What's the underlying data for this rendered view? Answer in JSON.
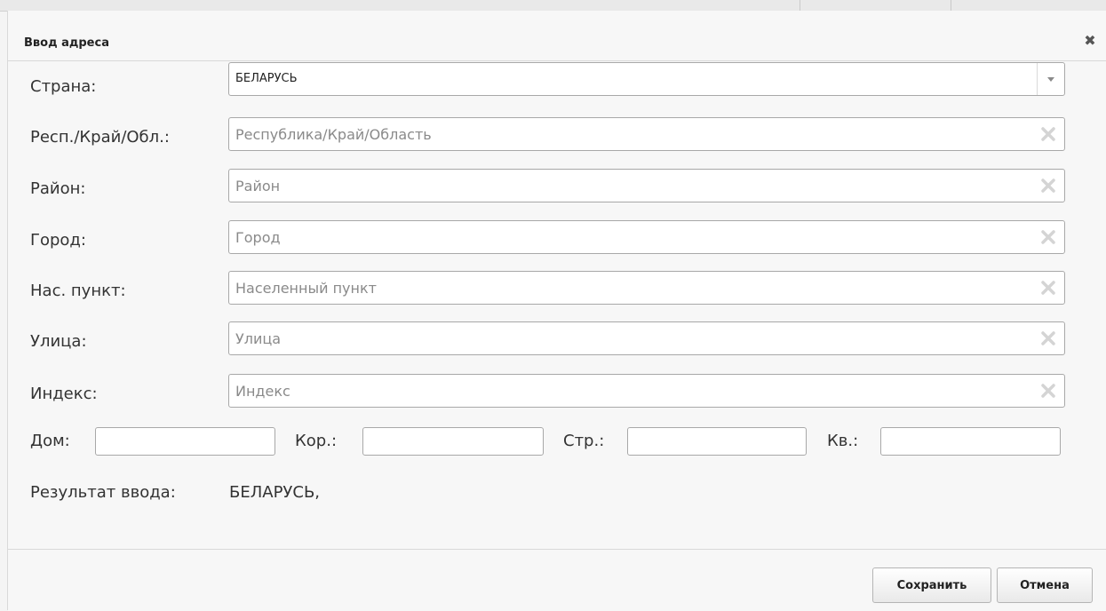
{
  "dialog": {
    "title": "Ввод адреса",
    "close_icon": "close-icon"
  },
  "form": {
    "country": {
      "label": "Страна:",
      "value": "БЕЛАРУСЬ",
      "icon": "chevron-down-icon"
    },
    "region": {
      "label": "Респ./Край/Обл.:",
      "placeholder": "Республика/Край/Область",
      "value": ""
    },
    "district": {
      "label": "Район:",
      "placeholder": "Район",
      "value": ""
    },
    "city": {
      "label": "Город:",
      "placeholder": "Город",
      "value": ""
    },
    "settlement": {
      "label": "Нас. пункт:",
      "placeholder": "Населенный пункт",
      "value": ""
    },
    "street": {
      "label": "Улица:",
      "placeholder": "Улица",
      "value": ""
    },
    "postcode": {
      "label": "Индекс:",
      "placeholder": "Индекс",
      "value": ""
    },
    "house": {
      "label": "Дом:",
      "value": ""
    },
    "building": {
      "label": "Кор.:",
      "value": ""
    },
    "structure": {
      "label": "Стр.:",
      "value": ""
    },
    "apartment": {
      "label": "Кв.:",
      "value": ""
    },
    "clear_icon": "clear-x-icon"
  },
  "result": {
    "label": "Результат ввода:",
    "value": "БЕЛАРУСЬ,"
  },
  "footer": {
    "save_label": "Сохранить",
    "cancel_label": "Отмена"
  }
}
